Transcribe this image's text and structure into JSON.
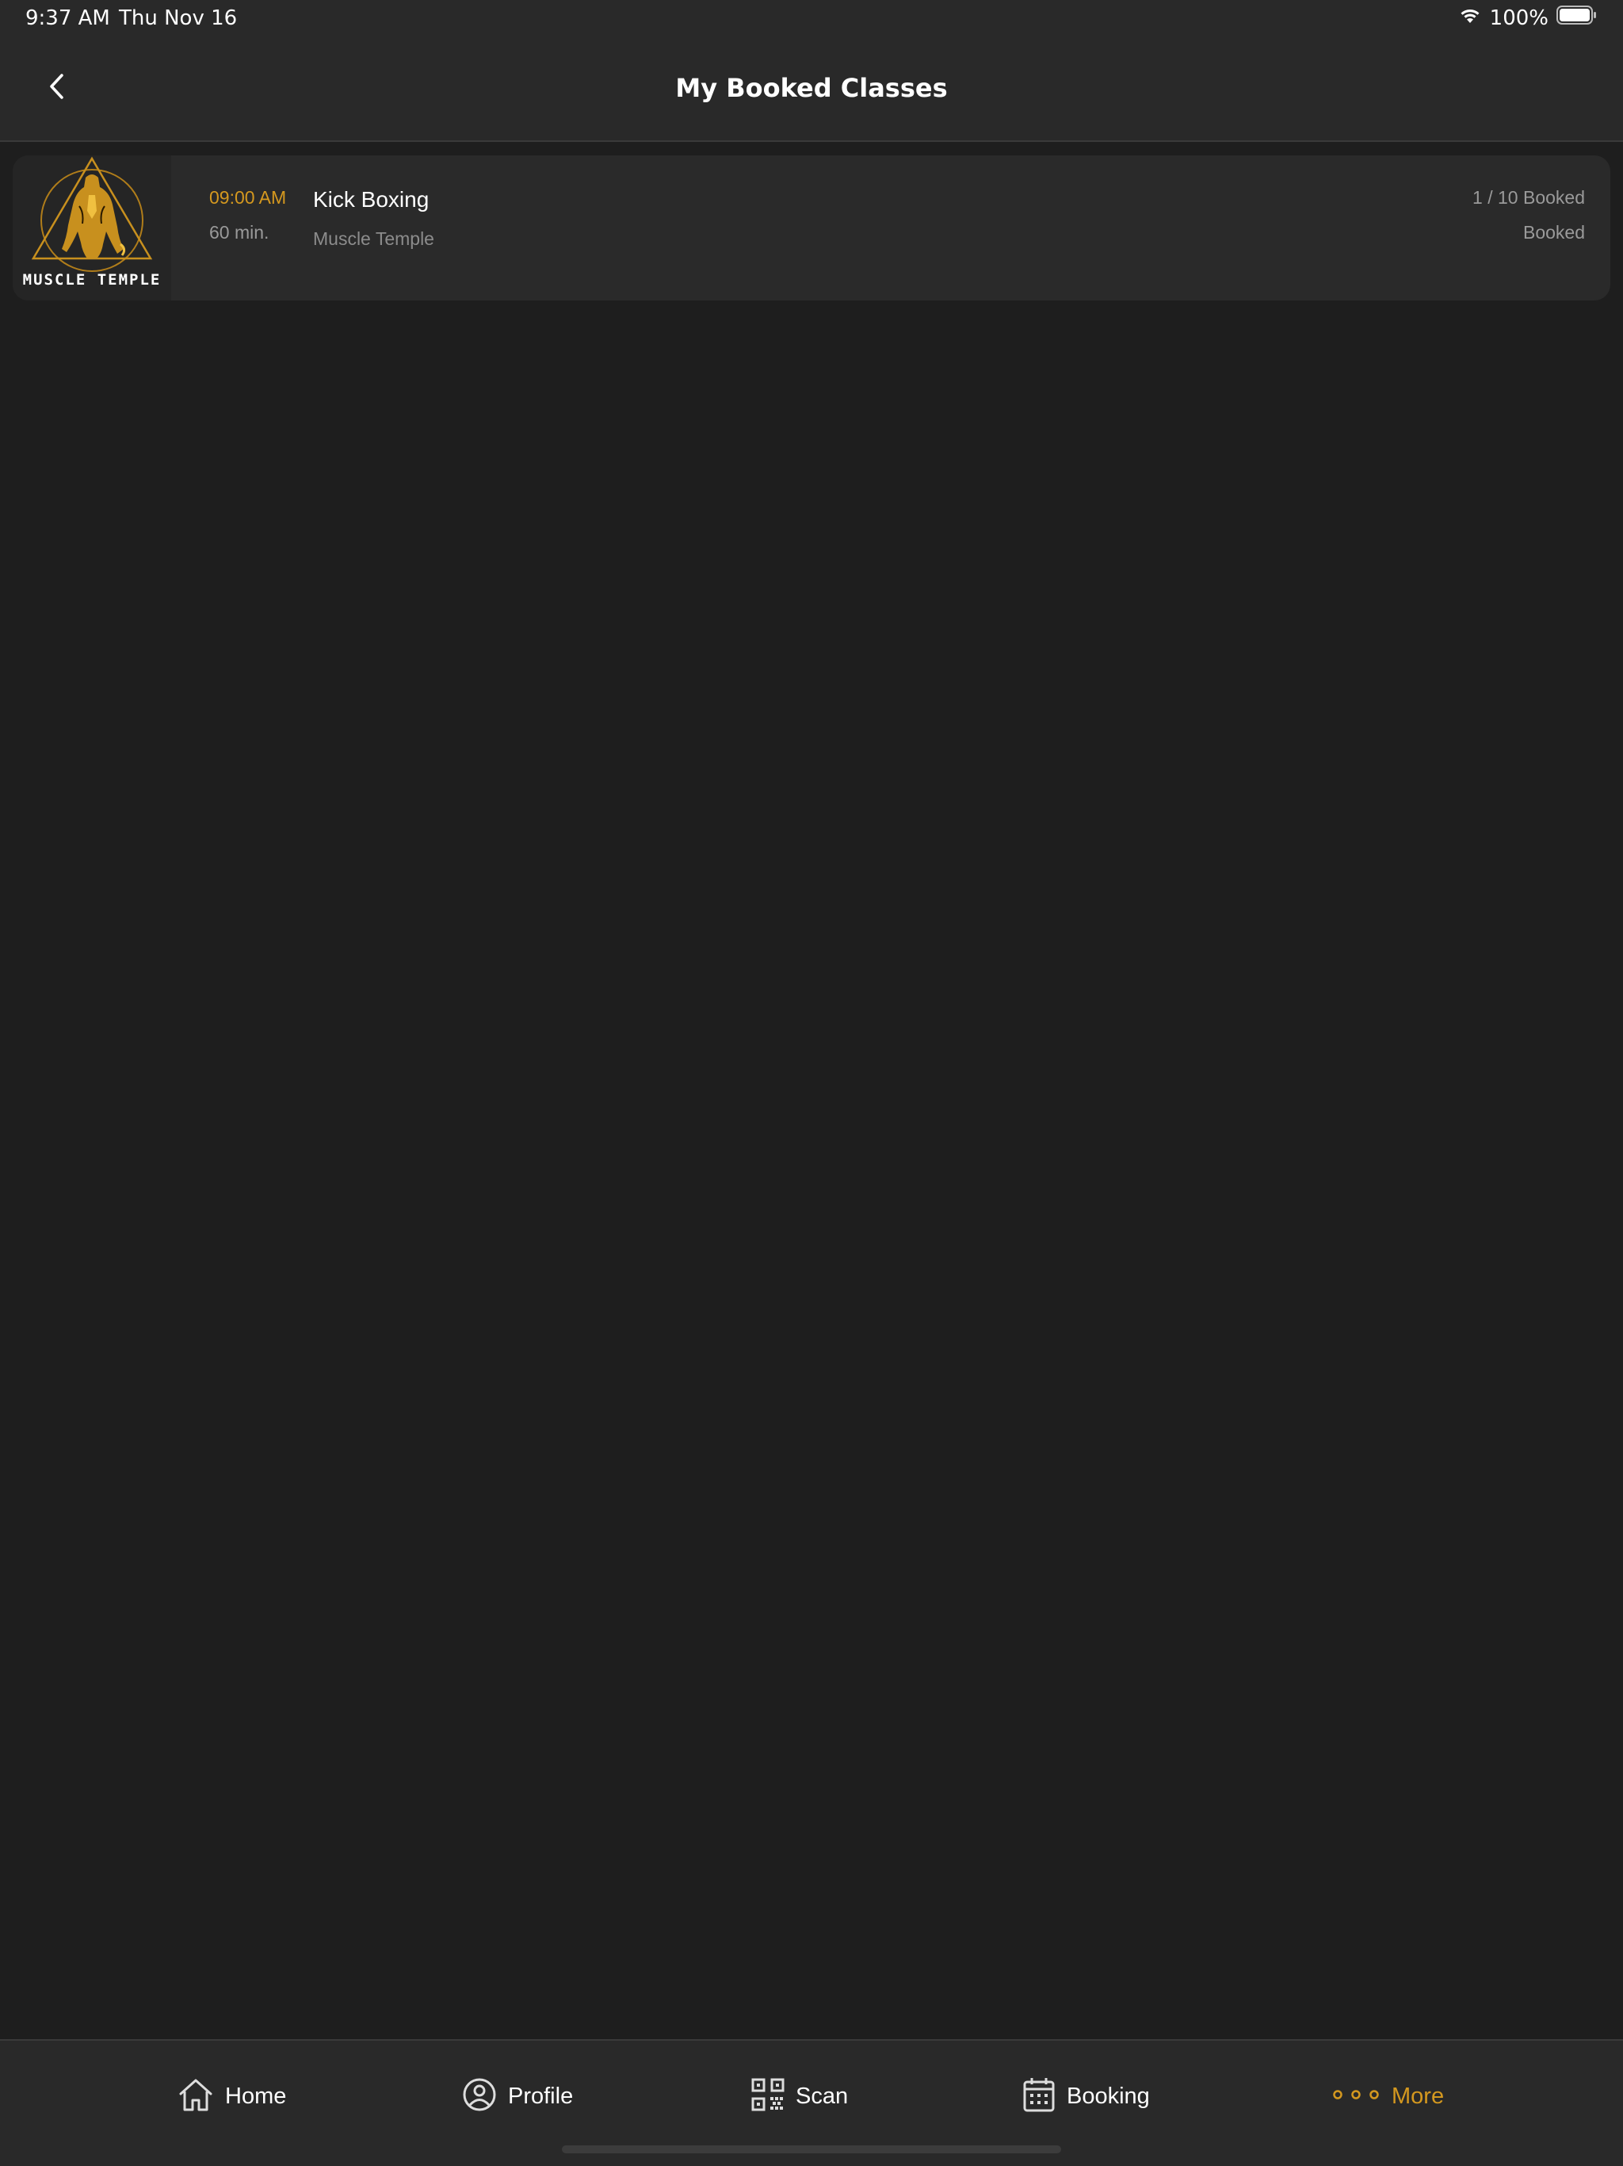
{
  "status_bar": {
    "time": "9:37 AM",
    "date": "Thu Nov 16",
    "battery": "100%"
  },
  "nav": {
    "title": "My Booked Classes"
  },
  "classes": [
    {
      "logo_text": "MUSCLE TEMPLE",
      "time": "09:00 AM",
      "duration": "60 min.",
      "name": "Kick Boxing",
      "location": "Muscle Temple",
      "capacity": "1 / 10 Booked",
      "status": "Booked"
    }
  ],
  "tabs": [
    {
      "label": "Home",
      "icon": "home-icon"
    },
    {
      "label": "Profile",
      "icon": "profile-icon"
    },
    {
      "label": "Scan",
      "icon": "qr-code-icon"
    },
    {
      "label": "Booking",
      "icon": "calendar-icon"
    },
    {
      "label": "More",
      "icon": "more-icon",
      "active": true
    }
  ],
  "colors": {
    "accent": "#d4981f",
    "background": "#1e1e1e",
    "bar": "#292929",
    "card": "#2a2a2a"
  }
}
